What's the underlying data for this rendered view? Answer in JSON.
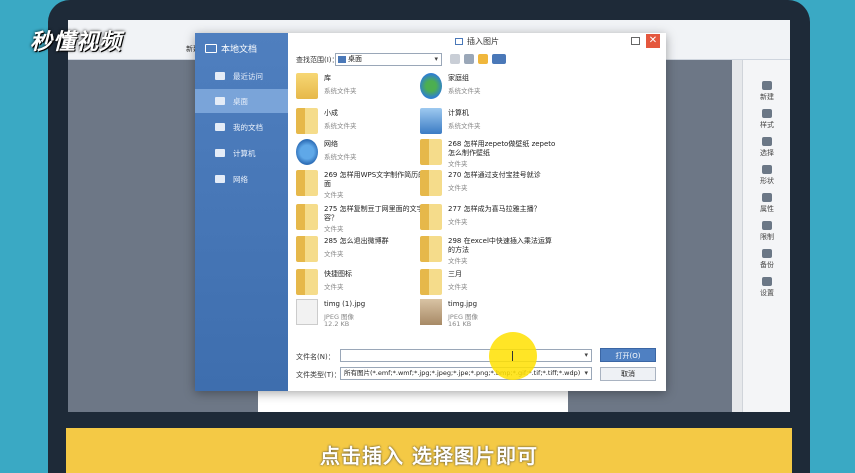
{
  "watermark": "秒懂视频",
  "app": {
    "top_tab": "新建",
    "right_panel": [
      "新建",
      "样式",
      "选择",
      "形状",
      "属性",
      "限制",
      "备份",
      "设置"
    ]
  },
  "dialog": {
    "title": "插入图片",
    "sidebar": {
      "title": "本地文档",
      "items": [
        "最近访问",
        "桌面",
        "我的文档",
        "计算机",
        "网络"
      ],
      "active": "桌面"
    },
    "lookin_label": "查找范围(I)：",
    "lookin_value": "桌面",
    "files": [
      {
        "name": "库",
        "type": "系统文件夹",
        "icon": "library-icon"
      },
      {
        "name": "家庭组",
        "type": "系统文件夹",
        "icon": "homegroup-icon"
      },
      {
        "name": "小成",
        "type": "系统文件夹",
        "icon": "user-folder-icon"
      },
      {
        "name": "计算机",
        "type": "系统文件夹",
        "icon": "computer-icon"
      },
      {
        "name": "网络",
        "type": "系统文件夹",
        "icon": "network-icon"
      },
      {
        "name": "268 怎样用zepeto做壁纸 zepeto怎么制作壁纸",
        "type": "文件夹",
        "icon": "folder-icon"
      },
      {
        "name": "269 怎样用WPS文字制作简历的封面",
        "type": "文件夹",
        "icon": "folder-icon"
      },
      {
        "name": "270 怎样通过支付宝挂号就诊",
        "type": "文件夹",
        "icon": "folder-icon"
      },
      {
        "name": "275 怎样复制豆丁网里面的文字内容？",
        "type": "文件夹",
        "icon": "folder-icon"
      },
      {
        "name": "277 怎样成为喜马拉雅主播？",
        "type": "文件夹",
        "icon": "folder-icon"
      },
      {
        "name": "285 怎么退出微博群",
        "type": "文件夹",
        "icon": "folder-icon"
      },
      {
        "name": "298 在excel中快速插入乘法运算的方法",
        "type": "文件夹",
        "icon": "folder-icon"
      },
      {
        "name": "快捷图标",
        "type": "文件夹",
        "icon": "folder-icon"
      },
      {
        "name": "三月",
        "type": "文件夹",
        "icon": "folder-icon"
      },
      {
        "name": "timg (1).jpg",
        "type": "JPEG 图像",
        "size": "12.2 KB",
        "icon": "image-thumb-icon"
      },
      {
        "name": "timg.jpg",
        "type": "JPEG 图像",
        "size": "161 KB",
        "icon": "image-thumb-icon"
      }
    ],
    "filename_label": "文件名(N)：",
    "filename_value": "",
    "filetype_label": "文件类型(T)：",
    "filetype_value": "所有图片(*.emf;*.wmf;*.jpg;*.jpeg;*.jpe;*.png;*.bmp;*.gif;*.tif;*.tiff;*.wdp)",
    "open_button": "打开(O)",
    "cancel_button": "取消"
  },
  "subtitle": "点击插入 选择图片即可",
  "colors": {
    "dialog_sidebar": "#4f7fbf",
    "open_button": "#4f80c2",
    "subtitle_bar": "#f4c945",
    "close_button": "#e4573d"
  }
}
